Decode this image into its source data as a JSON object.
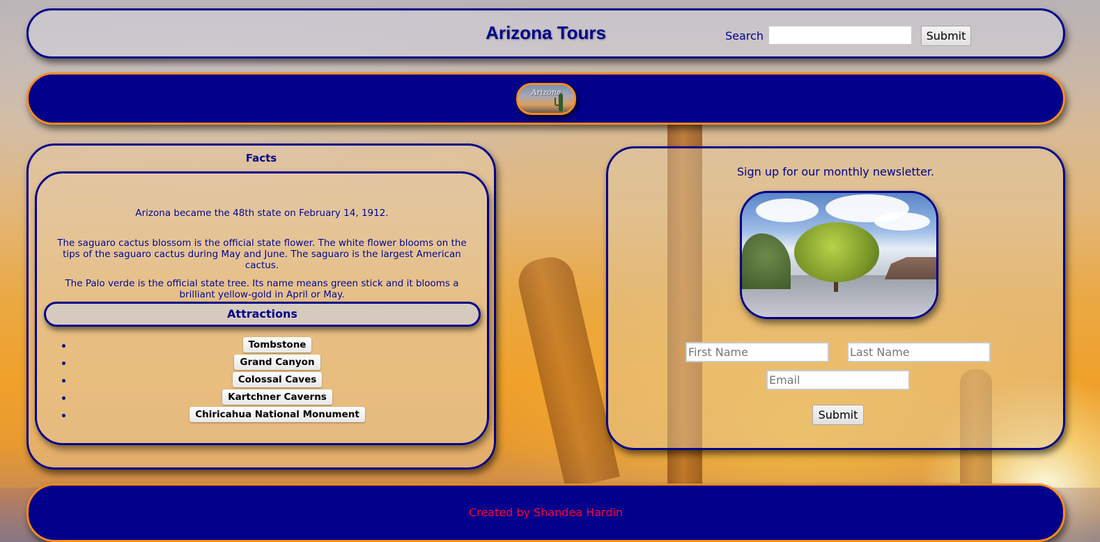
{
  "header": {
    "site_title": "Arizona Tours",
    "search_label": "Search",
    "search_value": "",
    "search_submit_label": "Submit"
  },
  "banner": {
    "logo_text": "Arizona"
  },
  "facts": {
    "heading": "Facts",
    "items": [
      "Arizona became the 48th state on February 14, 1912.",
      "The saguaro cactus blossom is the official state flower. The white flower blooms on the tips of the saguaro cactus during May and June. The saguaro is the largest American cactus.",
      "The Palo verde is the official state tree. Its name means green stick and it blooms a brilliant yellow-gold in April or May."
    ],
    "attractions_heading": "Attractions",
    "attractions": [
      "Tombstone",
      "Grand Canyon",
      "Colossal Caves",
      "Kartchner Caverns",
      "Chiricahua National Monument"
    ]
  },
  "newsletter": {
    "heading": "Sign up for our monthly newsletter.",
    "first_name_placeholder": "First Name",
    "last_name_placeholder": "Last Name",
    "email_placeholder": "Email",
    "submit_label": "Submit"
  },
  "footer": {
    "credit": "Created by Shandea Hardin"
  },
  "colors": {
    "navy": "#00008b",
    "orange_border": "#ff8c1a",
    "footer_text": "#ff0033"
  }
}
